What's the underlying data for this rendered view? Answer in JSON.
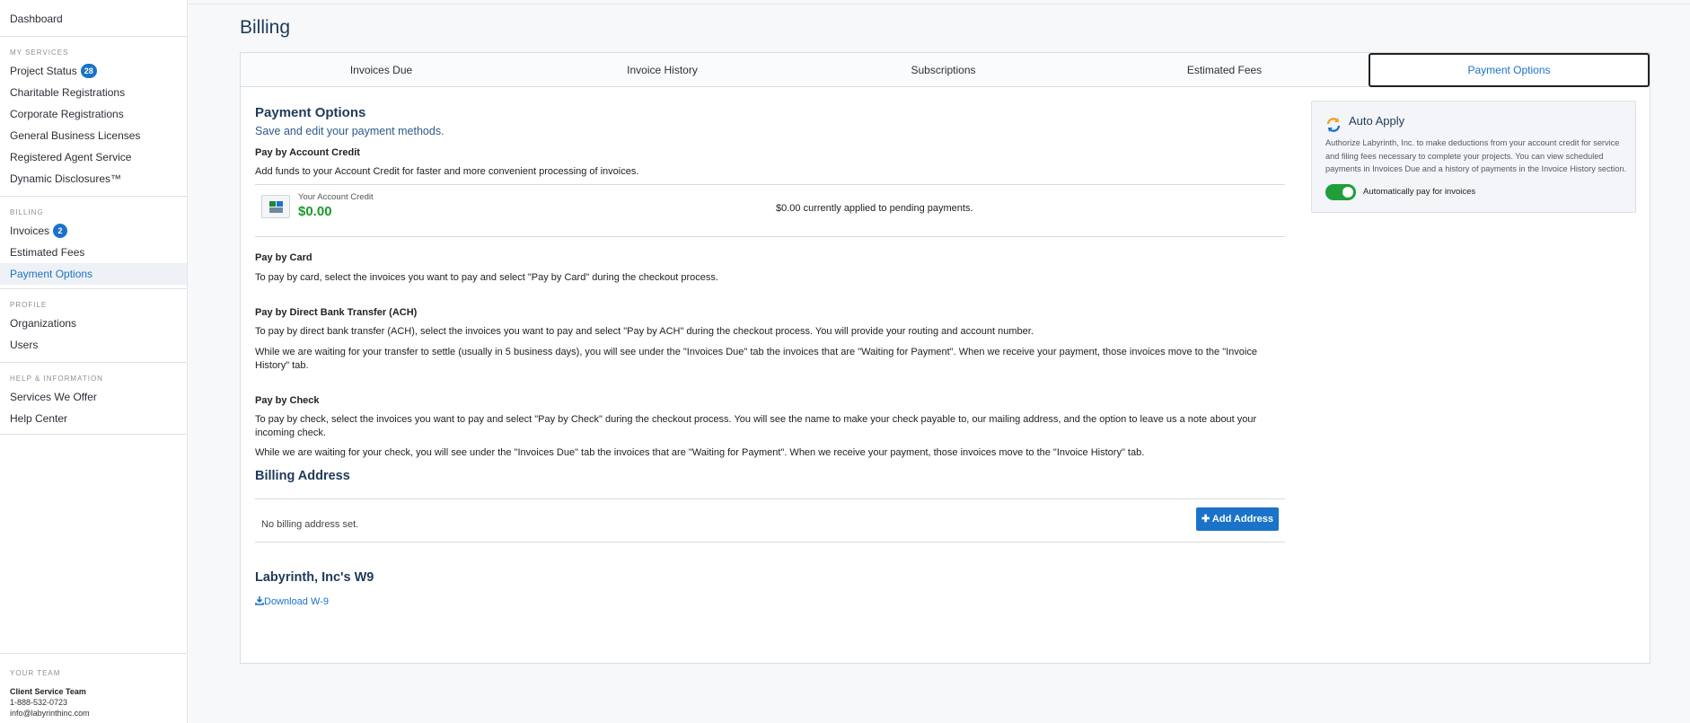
{
  "sidebar": {
    "dashboard": "Dashboard",
    "my_services": {
      "heading": "MY SERVICES",
      "items": [
        {
          "label": "Project Status",
          "badge": "28"
        },
        {
          "label": "Charitable Registrations"
        },
        {
          "label": "Corporate Registrations"
        },
        {
          "label": "General Business Licenses"
        },
        {
          "label": "Registered Agent Service"
        },
        {
          "label": "Dynamic Disclosures™"
        }
      ]
    },
    "billing": {
      "heading": "BILLING",
      "items": [
        {
          "label": "Invoices",
          "badge": "2"
        },
        {
          "label": "Estimated Fees"
        },
        {
          "label": "Payment Options",
          "active": true
        }
      ]
    },
    "profile": {
      "heading": "PROFILE",
      "items": [
        {
          "label": "Organizations"
        },
        {
          "label": "Users"
        }
      ]
    },
    "help": {
      "heading": "HELP & INFORMATION",
      "items": [
        {
          "label": "Services We Offer"
        },
        {
          "label": "Help Center"
        }
      ]
    },
    "team": {
      "heading": "YOUR TEAM",
      "name": "Client Service Team",
      "phone": "1-888-532-0723",
      "email": "info@labyrinthinc.com"
    }
  },
  "page": {
    "title": "Billing"
  },
  "tabs": [
    {
      "label": "Invoices Due"
    },
    {
      "label": "Invoice History"
    },
    {
      "label": "Subscriptions"
    },
    {
      "label": "Estimated Fees"
    },
    {
      "label": "Payment Options",
      "active": true
    }
  ],
  "payment_options": {
    "heading": "Payment Options",
    "subheading": "Save and edit your payment methods.",
    "account_credit": {
      "heading": "Pay by Account Credit",
      "text": "Add funds to your Account Credit for faster and more convenient processing of invoices.",
      "label": "Your Account Credit",
      "amount": "$0.00",
      "pending": "$0.00 currently applied to pending payments."
    },
    "card": {
      "heading": "Pay by Card",
      "text": "To pay by card, select the invoices you want to pay and select \"Pay by Card\" during the checkout process."
    },
    "ach": {
      "heading": "Pay by Direct Bank Transfer (ACH)",
      "text1": "To pay by direct bank transfer (ACH), select the invoices you want to pay and select \"Pay by ACH\" during the checkout process. You will provide your routing and account number.",
      "text2": "While we are waiting for your transfer to settle (usually in 5 business days), you will see under the \"Invoices Due\" tab the invoices that are \"Waiting for Payment\". When we receive your payment, those invoices move to the \"Invoice History\" tab."
    },
    "check": {
      "heading": "Pay by Check",
      "text1": "To pay by check, select the invoices you want to pay and select \"Pay by Check\" during the checkout process. You will see the name to make your check payable to, our mailing address, and the option to leave us a note about your incoming check.",
      "text2": "While we are waiting for your check, you will see under the \"Invoices Due\" tab the invoices that are \"Waiting for Payment\". When we receive your payment, those invoices move to the \"Invoice History\" tab."
    }
  },
  "billing_address": {
    "heading": "Billing Address",
    "empty": "No billing address set.",
    "add_button": "Add Address",
    "add_icon": "plus-icon"
  },
  "w9": {
    "heading": "Labyrinth, Inc's W9",
    "link": "Download W-9",
    "link_icon": "download-icon"
  },
  "auto_apply": {
    "title": "Auto Apply",
    "description": "Authorize Labyrinth, Inc. to make deductions from your account credit for service and filing fees necessary to complete your projects. You can view scheduled payments in Invoices Due and a history of payments in the Invoice History section.",
    "toggle_label": "Automatically pay for invoices",
    "toggle_on": true
  },
  "colors": {
    "accent": "#1a73c9",
    "credit_green": "#1a9a2a",
    "toggle_green": "#1f9e3a",
    "heading_navy": "#1f3a5a"
  }
}
